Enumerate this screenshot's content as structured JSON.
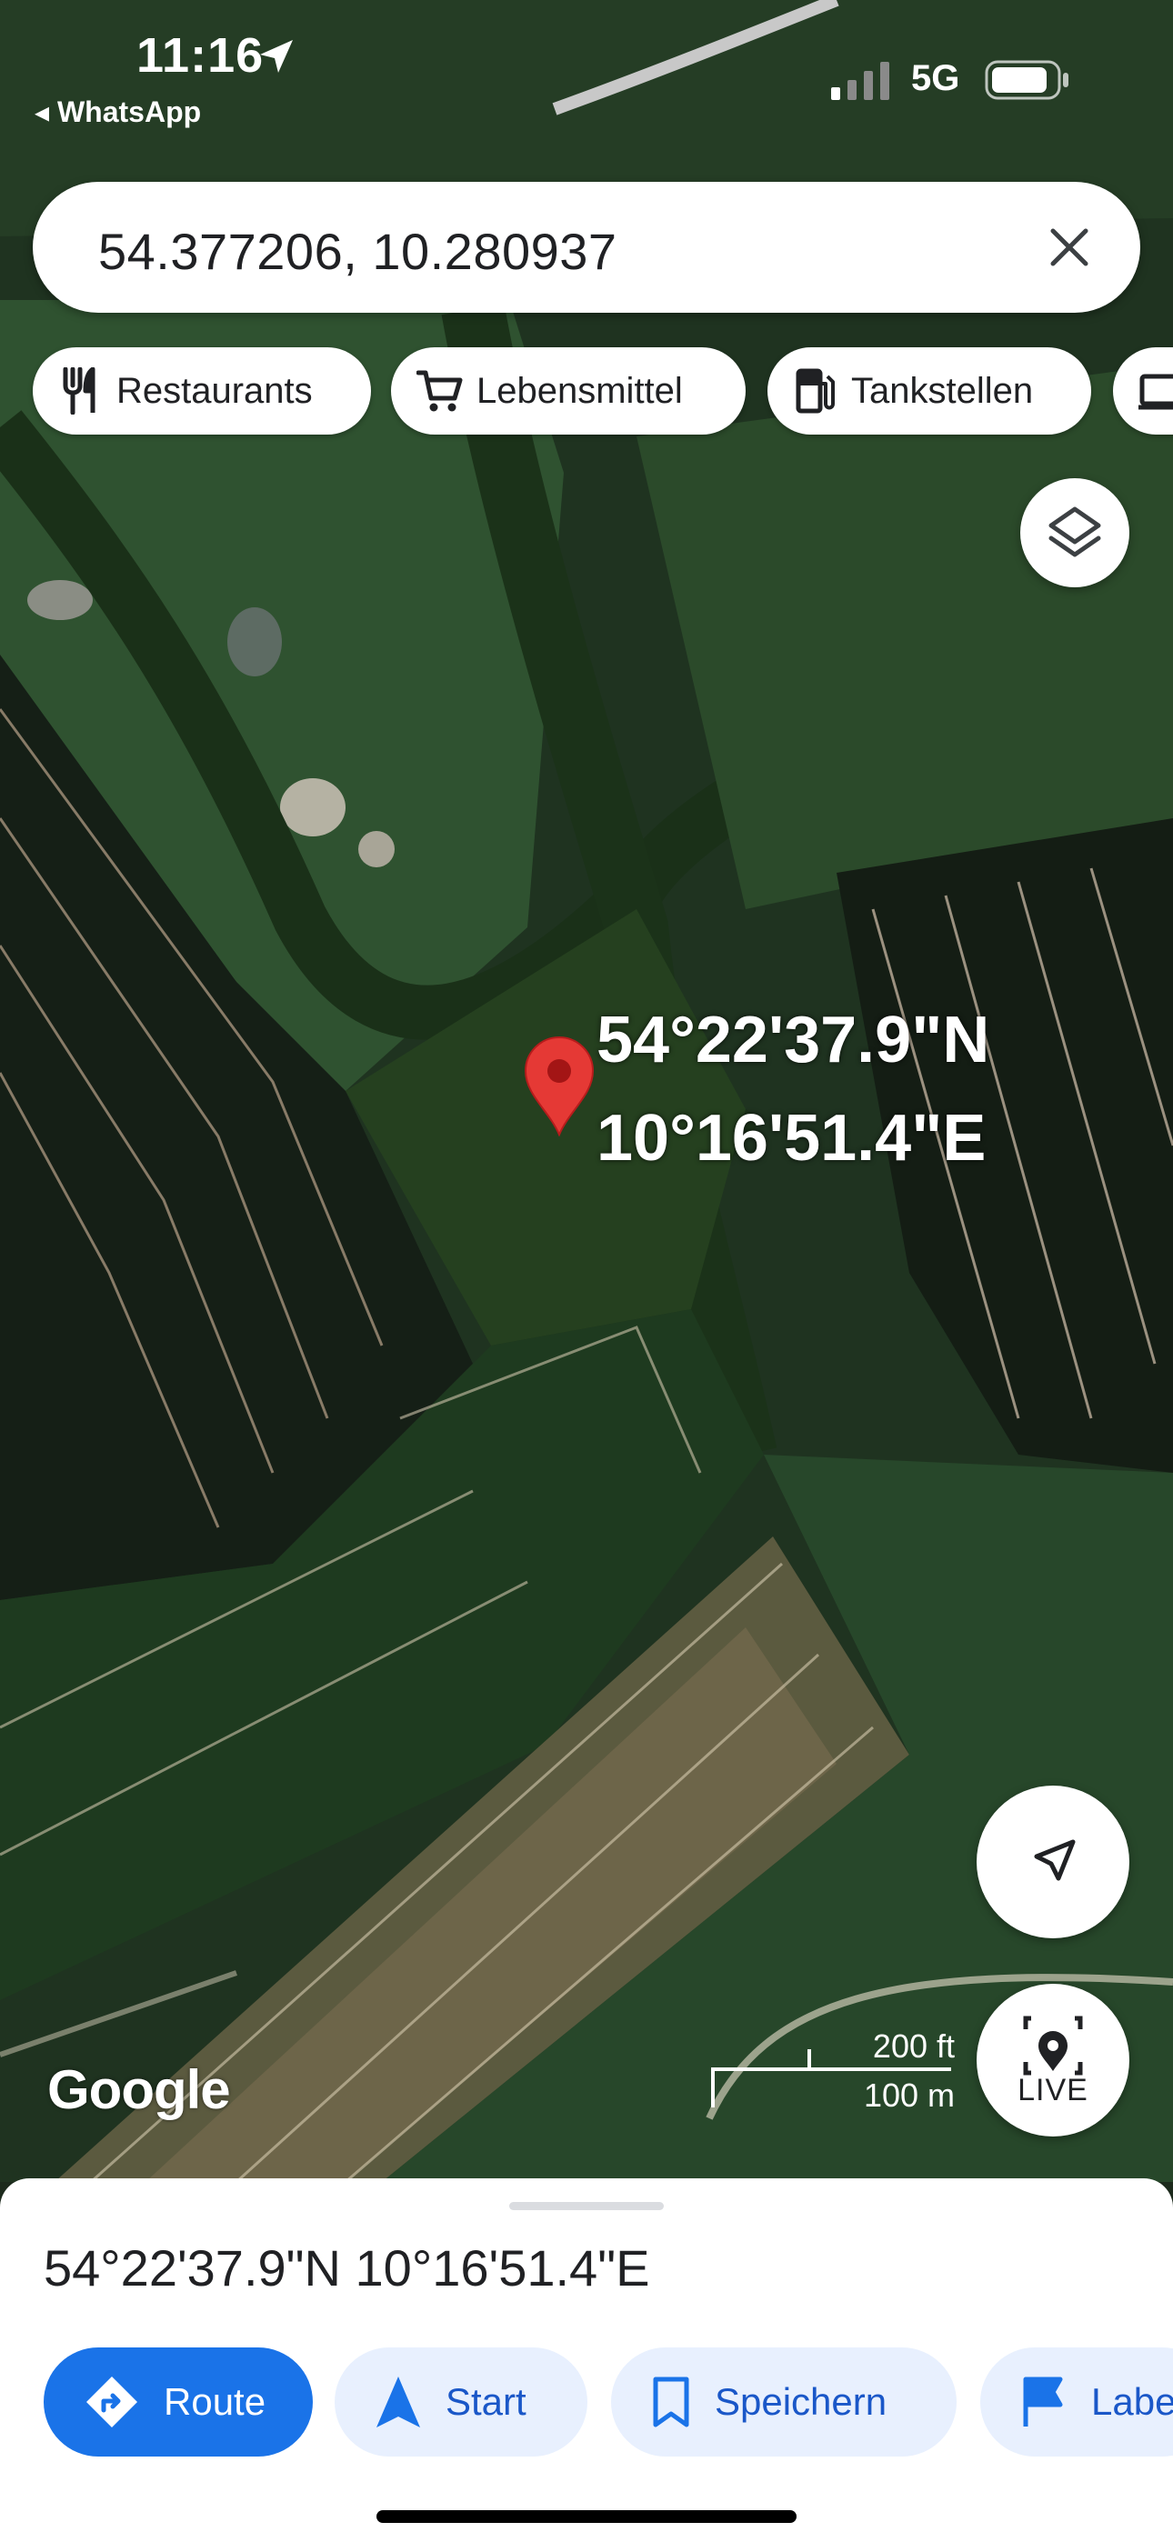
{
  "status_bar": {
    "time": "11:16",
    "back_app": "◂ WhatsApp",
    "network": "5G"
  },
  "search": {
    "value": "54.377206, 10.280937",
    "clear_icon": "close-icon"
  },
  "chips": [
    {
      "label": "Restaurants",
      "icon": "fork-knife-icon"
    },
    {
      "label": "Lebensmittel",
      "icon": "cart-icon"
    },
    {
      "label": "Tankstellen",
      "icon": "fuel-icon"
    }
  ],
  "map": {
    "pin_label_line1": "54°22'37.9\"N",
    "pin_label_line2": "10°16'51.4\"E",
    "logo": "Google",
    "scale_ft": "200 ft",
    "scale_m": "100 m",
    "live_label": "LIVE",
    "pin_color": "#e53935"
  },
  "sheet": {
    "title": "54°22'37.9\"N 10°16'51.4\"E",
    "actions": [
      {
        "label": "Route",
        "icon": "directions-icon"
      },
      {
        "label": "Start",
        "icon": "navigation-arrow-icon"
      },
      {
        "label": "Speichern",
        "icon": "bookmark-icon"
      },
      {
        "label": "Labe",
        "icon": "flag-icon"
      }
    ]
  },
  "colors": {
    "accent": "#1a73e8",
    "accent_light": "#e8f0fe"
  }
}
